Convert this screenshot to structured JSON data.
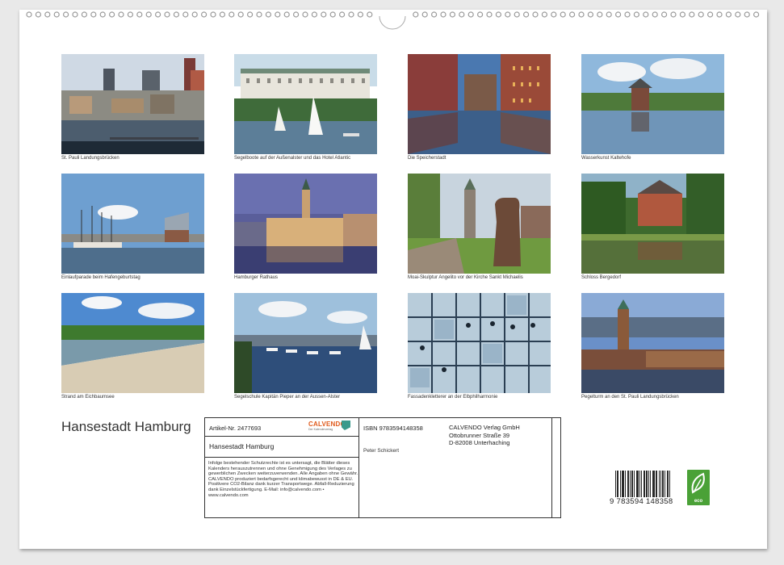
{
  "photos": [
    {
      "caption": "St. Pauli Landungsbrücken"
    },
    {
      "caption": "Segelboote auf der Außenalster und das Hotel Atlantic"
    },
    {
      "caption": "Die Speicherstadt"
    },
    {
      "caption": "Wasserkunst Kaltehofe"
    },
    {
      "caption": "Einlaufparade beim Hafengeburtstag"
    },
    {
      "caption": "Hamburger Rathaus"
    },
    {
      "caption": "Moai-Skulptur Angelito vor der Kirche Sankt Michaelis"
    },
    {
      "caption": "Schloss Bergedorf"
    },
    {
      "caption": "Strand am Eichbaumsee"
    },
    {
      "caption": "Segelschule Kapitän Pieper an der Aussen-Alster"
    },
    {
      "caption": "Fassadenkletterer an der Elbphilharmonie"
    },
    {
      "caption": "Pegelturm an den St. Pauli Landungsbrücken"
    }
  ],
  "calendar_title": "Hansestadt Hamburg",
  "info": {
    "article_no": "Artikel-Nr. 2477693",
    "product_title": "Hansestadt Hamburg",
    "legal_text": "Infolge bestehender Schutzrechte ist es untersagt, die Blätter dieses Kalenders herauszutrennen und ohne Genehmigung des Verlages zu gewerblichen Zwecken weiterzuverwenden. Alle Angaben ohne Gewähr. CALVENDO produziert bedarfsgerecht und klimabewusst in DE & EU. Positivere CO2-Bilanz dank kurzer Transportwege. Abfall-Reduzierung dank Einzelstückfertigung. E-Mail: info@calvendo.com • www.calvendo.com",
    "isbn": "ISBN 9783594148358",
    "author": "Peter Schickert",
    "publisher_lines": [
      "CALVENDO Verlag GmbH",
      "Ottobrunner Straße 39",
      "D-82008 Unterhaching"
    ],
    "calvendo_brand": "CALVENDO",
    "calvendo_sub": "Der Kalenderverlag",
    "barcode_number": "9 783594 148358",
    "eco_label": "eco"
  },
  "colors": {
    "calvendo_orange": "#e05a1c",
    "calvendo_teal": "#3a9a8c",
    "eco_green": "#4aa137"
  }
}
